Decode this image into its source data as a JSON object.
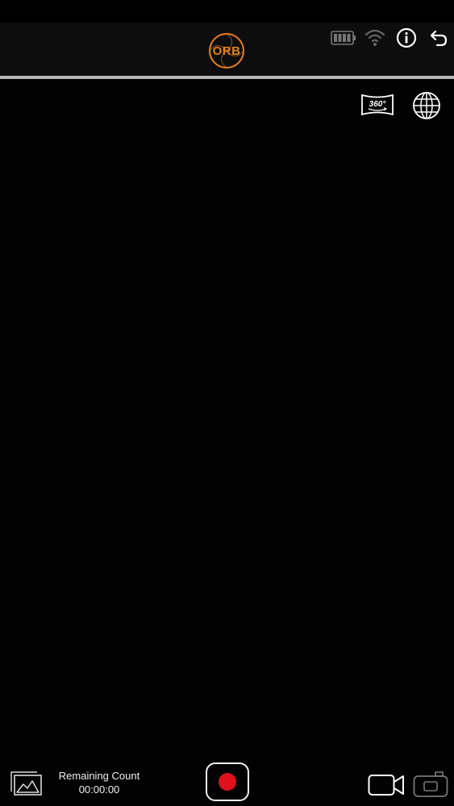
{
  "header": {
    "logo_text": "ORB",
    "logo_color": "#e6801e",
    "icons": [
      "battery-icon",
      "wifi-icon",
      "info-icon",
      "back-icon"
    ]
  },
  "view_controls": {
    "icons": [
      "panorama-360-icon",
      "globe-icon"
    ],
    "panorama_label": "360°"
  },
  "footer": {
    "remaining_label": "Remaining Count",
    "remaining_time": "00:00:00",
    "record_color": "#e0101c",
    "icons": [
      "gallery-icon",
      "record-button",
      "video-mode-icon",
      "photo-mode-icon"
    ]
  }
}
